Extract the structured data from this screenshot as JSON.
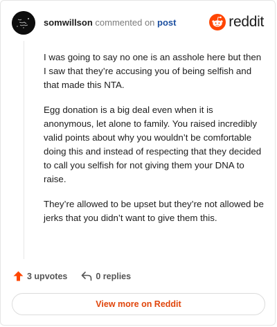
{
  "header": {
    "username": "somwillson",
    "action_text": "commented on",
    "post_link": "post"
  },
  "brand": {
    "wordmark": "reddit",
    "accent_color": "#ff4500",
    "logo_icon": "reddit-snoo-icon"
  },
  "comment": {
    "paragraphs": [
      "I was going to say no one is an asshole here but then I saw that they’re accusing you of being selfish and that made this NTA.",
      "Egg donation is a big deal even when it is anonymous, let alone to family. You raised incredibly valid points about why you wouldn’t be comfortable doing this and instead of respecting that they decided to call you selfish for not giving them your DNA to raise.",
      "They’re allowed to be upset but they’re not allowed be jerks that you didn’t want to give them this."
    ]
  },
  "actions": {
    "upvotes_label": "3 upvotes",
    "upvote_icon": "upvote-arrow-icon",
    "upvote_color": "#ff4500",
    "replies_label": "0 replies",
    "reply_icon": "reply-arrow-icon"
  },
  "footer": {
    "view_more_label": "View more on Reddit"
  }
}
